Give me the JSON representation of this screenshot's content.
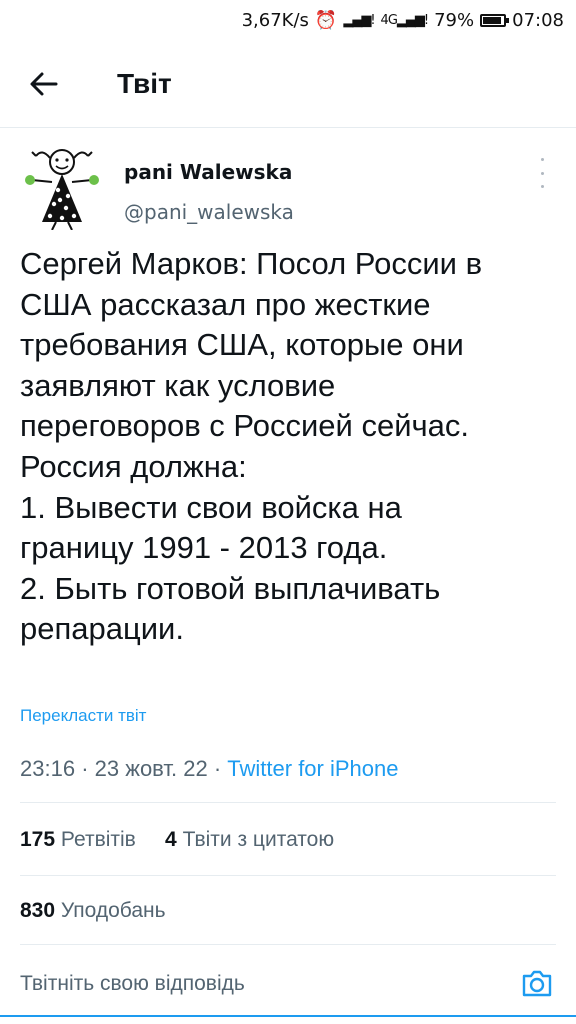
{
  "status_bar": {
    "speed": "3,67K/s",
    "battery_percent": "79%",
    "battery_level": 0.79,
    "time": "07:08"
  },
  "header": {
    "title": "Твіт"
  },
  "author": {
    "name": "pani Walewska",
    "handle": "@pani_walewska"
  },
  "tweet": {
    "text": "Сергей Марков: Посол России в\nСША рассказал про жесткие\nтребования США, которые они\nзаявляют как условие\nпереговоров с Россией сейчас.\nРоссия должна:\n1. Вывести свои войска на\nграницу 1991 - 2013 года.\n2. Быть готовой выплачивать\nрепарации.",
    "translate_label": "Перекласти твіт",
    "time": "23:16",
    "date": "23 жовт. 22",
    "source": "Twitter for iPhone"
  },
  "stats": {
    "retweets_count": "175",
    "retweets_label": "Ретвітів",
    "quotes_count": "4",
    "quotes_label": "Твіти з цитатою",
    "likes_count": "830",
    "likes_label": "Уподобань"
  },
  "reply": {
    "placeholder": "Твітніть свою відповідь"
  },
  "icons": {
    "back": "arrow-left-icon",
    "more": "more-vertical-icon",
    "camera": "camera-icon"
  },
  "colors": {
    "accent": "#1d9bf0",
    "secondary_text": "#536471",
    "divider": "#e6ecf0"
  }
}
